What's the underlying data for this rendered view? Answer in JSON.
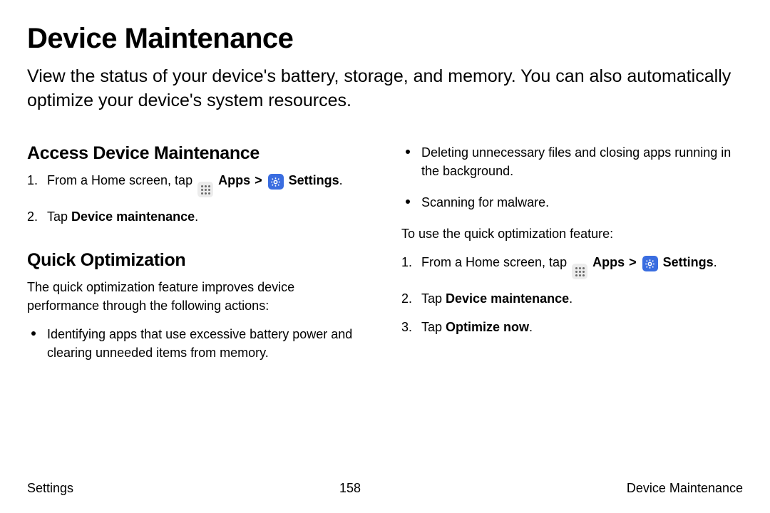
{
  "title": "Device Maintenance",
  "subtitle": "View the status of your device's battery, storage, and memory. You can also automatically optimize your device's system resources.",
  "left": {
    "access_h": "Access Device Maintenance",
    "access_steps": {
      "s1_pre": "From a Home screen, tap ",
      "s1_apps": "Apps",
      "s1_settings": "Settings",
      "s1_end": ".",
      "s2_pre": "Tap ",
      "s2_bold": "Device maintenance",
      "s2_end": "."
    },
    "quick_h": "Quick Optimization",
    "quick_intro": "The quick optimization feature improves device performance through the following actions:",
    "quick_b1": "Identifying apps that use excessive battery power and clearing unneeded items from memory."
  },
  "right": {
    "b1": "Deleting unnecessary files and closing apps running in the background.",
    "b2": "Scanning for malware.",
    "use_intro": "To use the quick optimization feature:",
    "steps": {
      "s1_pre": "From a Home screen, tap ",
      "s1_apps": "Apps",
      "s1_settings": "Settings",
      "s1_end": ".",
      "s2_pre": "Tap ",
      "s2_bold": "Device maintenance",
      "s2_end": ".",
      "s3_pre": "Tap ",
      "s3_bold": "Optimize now",
      "s3_end": "."
    }
  },
  "footer": {
    "left": "Settings",
    "center": "158",
    "right": "Device Maintenance"
  },
  "sep": " > "
}
